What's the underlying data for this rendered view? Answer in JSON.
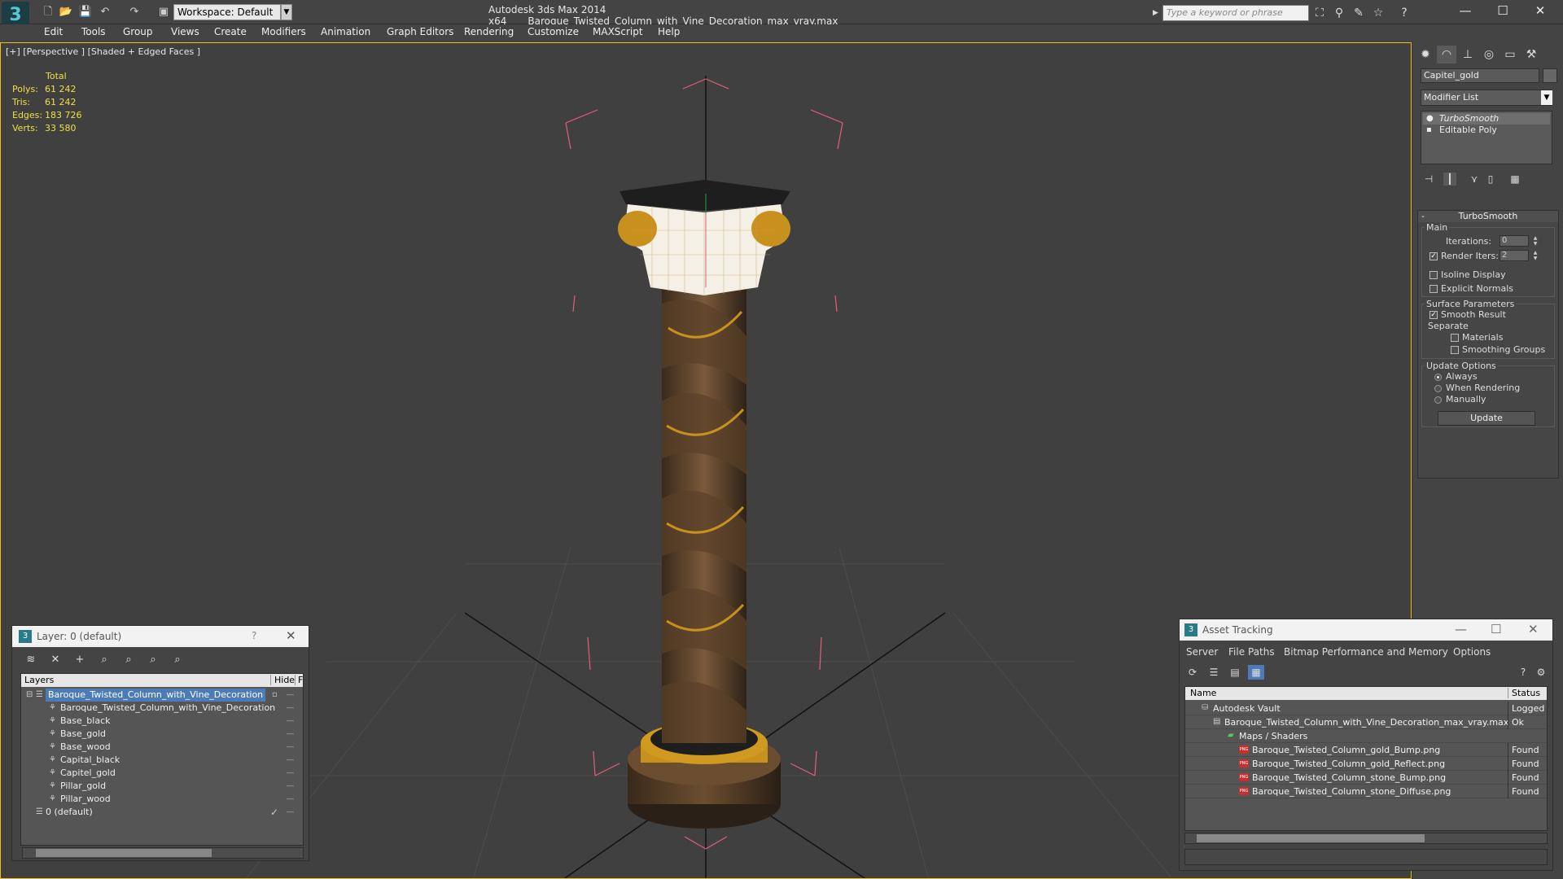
{
  "app": {
    "name": "Autodesk 3ds Max  2014 x64",
    "file": "Baroque_Twisted_Column_with_Vine_Decoration_max_vray.max",
    "workspace": "Workspace: Default",
    "search_placeholder": "Type a keyword or phrase"
  },
  "menu": [
    "Edit",
    "Tools",
    "Group",
    "Views",
    "Create",
    "Modifiers",
    "Animation",
    "Graph Editors",
    "Rendering",
    "Customize",
    "MAXScript",
    "Help"
  ],
  "viewport": {
    "label": "[+] [Perspective ] [Shaded + Edged Faces ]",
    "stats": {
      "header": "Total",
      "rows": [
        {
          "label": "Polys:",
          "value": "61 242"
        },
        {
          "label": "Tris:",
          "value": "61 242"
        },
        {
          "label": "Edges:",
          "value": "183 726"
        },
        {
          "label": "Verts:",
          "value": "33 580"
        }
      ]
    }
  },
  "command_panel": {
    "object_name": "Capitel_gold",
    "modifier_list": "Modifier List",
    "stack": [
      "TurboSmooth",
      "Editable Poly"
    ],
    "rollout": {
      "title": "TurboSmooth",
      "main_label": "Main",
      "iterations_label": "Iterations:",
      "iterations_value": "0",
      "render_iters_label": "Render Iters:",
      "render_iters_value": "2",
      "isoline": "Isoline Display",
      "explicit_normals": "Explicit Normals",
      "surface_params": "Surface Parameters",
      "smooth_result": "Smooth Result",
      "separate": "Separate",
      "materials": "Materials",
      "smoothing_groups": "Smoothing Groups",
      "update_options": "Update Options",
      "always": "Always",
      "when_rendering": "When Rendering",
      "manually": "Manually",
      "update_button": "Update"
    }
  },
  "layer_dialog": {
    "title": "Layer: 0 (default)",
    "help": "?",
    "col_layers": "Layers",
    "col_hide": "Hide",
    "col_fr": "Fr",
    "rows": [
      "Baroque_Twisted_Column_with_Vine_Decoration",
      "Baroque_Twisted_Column_with_Vine_Decoration",
      "Base_black",
      "Base_gold",
      "Base_wood",
      "Capital_black",
      "Capitel_gold",
      "Pillar_gold",
      "Pillar_wood",
      "0 (default)"
    ]
  },
  "asset_tracking": {
    "title": "Asset Tracking",
    "menu": [
      "Server",
      "File",
      "Paths",
      "Bitmap Performance and Memory",
      "Options"
    ],
    "col_name": "Name",
    "col_status": "Status",
    "rows": [
      {
        "name": "Autodesk Vault",
        "status": "Logged O"
      },
      {
        "name": "Baroque_Twisted_Column_with_Vine_Decoration_max_vray.max",
        "status": "Ok"
      },
      {
        "name": "Maps / Shaders",
        "status": ""
      },
      {
        "name": "Baroque_Twisted_Column_gold_Bump.png",
        "status": "Found"
      },
      {
        "name": "Baroque_Twisted_Column_gold_Reflect.png",
        "status": "Found"
      },
      {
        "name": "Baroque_Twisted_Column_stone_Bump.png",
        "status": "Found"
      },
      {
        "name": "Baroque_Twisted_Column_stone_Diffuse.png",
        "status": "Found"
      }
    ]
  },
  "colors": {
    "viewport_bg": "#404040",
    "active_border": "#f0c020",
    "stats_text": "#f0e040",
    "gizmo": "#e0607a",
    "selection": "#4d7bb8"
  }
}
